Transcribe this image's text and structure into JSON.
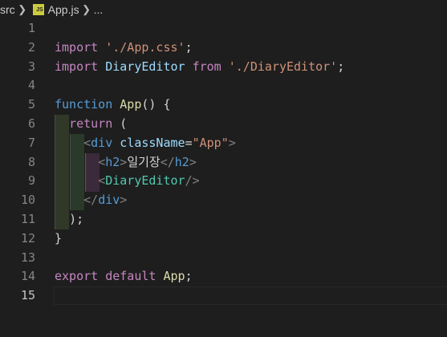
{
  "breadcrumb": {
    "folder": "src",
    "file_icon": "JS",
    "file": "App.js",
    "more": "..."
  },
  "editor": {
    "active_line": 15,
    "line_numbers": [
      "1",
      "2",
      "3",
      "4",
      "5",
      "6",
      "7",
      "8",
      "9",
      "10",
      "11",
      "12",
      "13",
      "14",
      "15"
    ],
    "lines": {
      "l2": {
        "kw": "import",
        "str": "'./App.css'",
        "end": ";"
      },
      "l3": {
        "kw": "import",
        "id": "DiaryEditor",
        "from": "from",
        "str": "'./DiaryEditor'",
        "end": ";"
      },
      "l5": {
        "kw": "function",
        "fn": "App",
        "rest": "() {"
      },
      "l6": {
        "kw": "return",
        "rest": " ("
      },
      "l7": {
        "open": "<",
        "tag": "div",
        "attr": "className",
        "eq": "=",
        "str": "\"App\"",
        "close": ">"
      },
      "l8": {
        "open": "<",
        "tag": "h2",
        "close": ">",
        "text": "일기장",
        "open2": "</",
        "tag2": "h2",
        "close2": ">"
      },
      "l9": {
        "open": "<",
        "tag": "DiaryEditor",
        "close": "/>"
      },
      "l10": {
        "open": "</",
        "tag": "div",
        "close": ">"
      },
      "l11": {
        "rest": ");"
      },
      "l12": {
        "rest": "}"
      },
      "l14": {
        "kw": "export",
        "kw2": "default",
        "fn": "App",
        "end": ";"
      }
    }
  },
  "colors": {
    "background": "#1e1e1e",
    "keyword": "#c586c0",
    "string": "#ce9178",
    "function": "#dcdcaa",
    "variable": "#9cdcfe",
    "tag": "#569cd6",
    "component": "#4ec9b0"
  }
}
